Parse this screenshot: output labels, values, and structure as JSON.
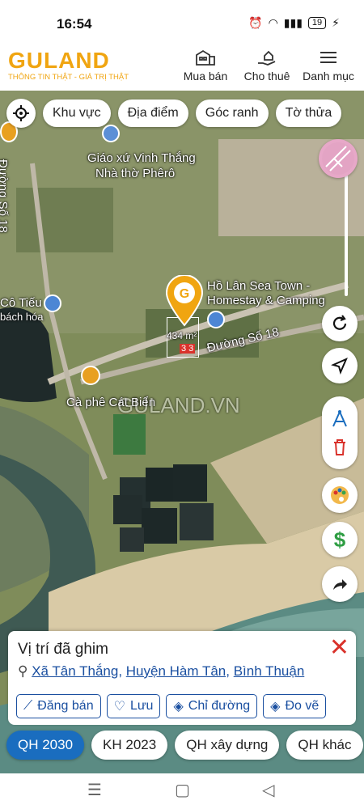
{
  "status": {
    "time": "16:54",
    "battery": "19"
  },
  "header": {
    "logo": "GULAND",
    "tagline": "THÔNG TIN THẬT - GIÁ TRỊ THẬT",
    "nav": [
      {
        "label": "Mua bán",
        "icon": "building-icon"
      },
      {
        "label": "Cho thuê",
        "icon": "hand-house-icon"
      },
      {
        "label": "Danh mục",
        "icon": "menu-icon"
      }
    ]
  },
  "filters": [
    "Khu vực",
    "Địa điểm",
    "Góc ranh",
    "Tờ thửa"
  ],
  "map": {
    "labels": {
      "church": "Giáo xứ Vinh Thắng",
      "church2": "Nhà thờ Phêrô",
      "road18": "Đường Số 18",
      "road18b": "Đường Số 18",
      "homestay": "Hồ Lân Sea Town -",
      "homestay2": "Homestay & Camping",
      "coffee": "Cà phê Cát Biển",
      "shop1": "Cô Tiếu",
      "shop2": "bách hóa",
      "watermark": "GULAND.VN",
      "area": "434 m²",
      "parcel": "3 3"
    }
  },
  "card": {
    "title": "Vị trí đã ghim",
    "address": [
      "Xã Tân Thắng",
      "Huyện Hàm Tân",
      "Bình Thuận"
    ],
    "actions": [
      {
        "label": "Đăng bán",
        "icon": "post-icon"
      },
      {
        "label": "Lưu",
        "icon": "heart-icon"
      },
      {
        "label": "Chỉ đường",
        "icon": "directions-icon"
      },
      {
        "label": "Đo vẽ",
        "icon": "measure-icon"
      }
    ]
  },
  "tabs": [
    "QH 2030",
    "KH 2023",
    "QH xây dựng",
    "QH khác"
  ],
  "colors": {
    "brand": "#f0a511",
    "accent": "#1a6dbf",
    "close": "#d9322b"
  }
}
